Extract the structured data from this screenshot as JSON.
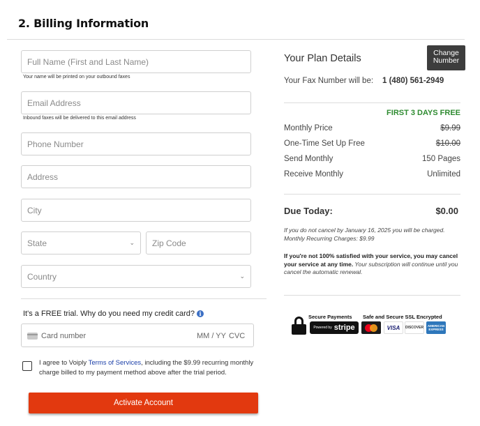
{
  "section": {
    "title": "2.  Billing Information"
  },
  "form": {
    "full_name": {
      "placeholder": "Full Name (First and Last Name)",
      "hint": "Your name will be printed on your outbound faxes"
    },
    "email": {
      "placeholder": "Email Address",
      "hint": "Inbound faxes will be delivered to this email address"
    },
    "phone": {
      "placeholder": "Phone Number"
    },
    "address": {
      "placeholder": "Address"
    },
    "city": {
      "placeholder": "City"
    },
    "state": {
      "placeholder": "State"
    },
    "zip": {
      "placeholder": "Zip Code"
    },
    "country": {
      "placeholder": "Country"
    }
  },
  "payment": {
    "why_text": "It's a FREE trial. Why do you need my credit card?",
    "card_number_placeholder": "Card number",
    "expiry_placeholder": "MM / YY",
    "cvc_placeholder": "CVC"
  },
  "agreement": {
    "prefix": "I agree to Voiply ",
    "link": "Terms of Services",
    "suffix": ", including the $9.99 recurring monthly charge billed to my payment method above after the trial period."
  },
  "actions": {
    "activate_label": "Activate Account"
  },
  "plan": {
    "title": "Your Plan Details",
    "change_button": "Change Number",
    "fax_label": "Your Fax Number will be:",
    "fax_number": "1 (480) 561-2949",
    "free_tag": "FIRST 3 DAYS FREE",
    "rows": [
      {
        "label": "Monthly Price",
        "value": "$9.99",
        "strike": true
      },
      {
        "label": "One-Time Set Up Free",
        "value": "$10.00",
        "strike": true
      },
      {
        "label": "Send Monthly",
        "value": "150 Pages",
        "strike": false
      },
      {
        "label": "Receive Monthly",
        "value": "Unlimited",
        "strike": false
      }
    ],
    "due_label": "Due Today:",
    "due_value": "$0.00",
    "cancel_note": "If you do not cancel by January 16, 2025 you will be charged. Monthly Recurring Charges: $9.99",
    "satisfaction_bold": "If you're not 100% satisfied with your service, you may cancel your service at any time.",
    "satisfaction_italic": " Your subscription will continue until you cancel the automatic renewal."
  },
  "badges": {
    "secure_payments": "Secure Payments",
    "powered_by": "Powered by",
    "stripe": "stripe",
    "ssl": "Safe and Secure SSL Encrypted",
    "visa": "VISA",
    "discover": "DISCOVER",
    "amex": "AMERICAN EXPRESS"
  },
  "colors": {
    "accent_button": "#e2390f",
    "free_green": "#2e8b30",
    "link_blue": "#1a3ea8",
    "change_button_bg": "#3d3d3d"
  }
}
